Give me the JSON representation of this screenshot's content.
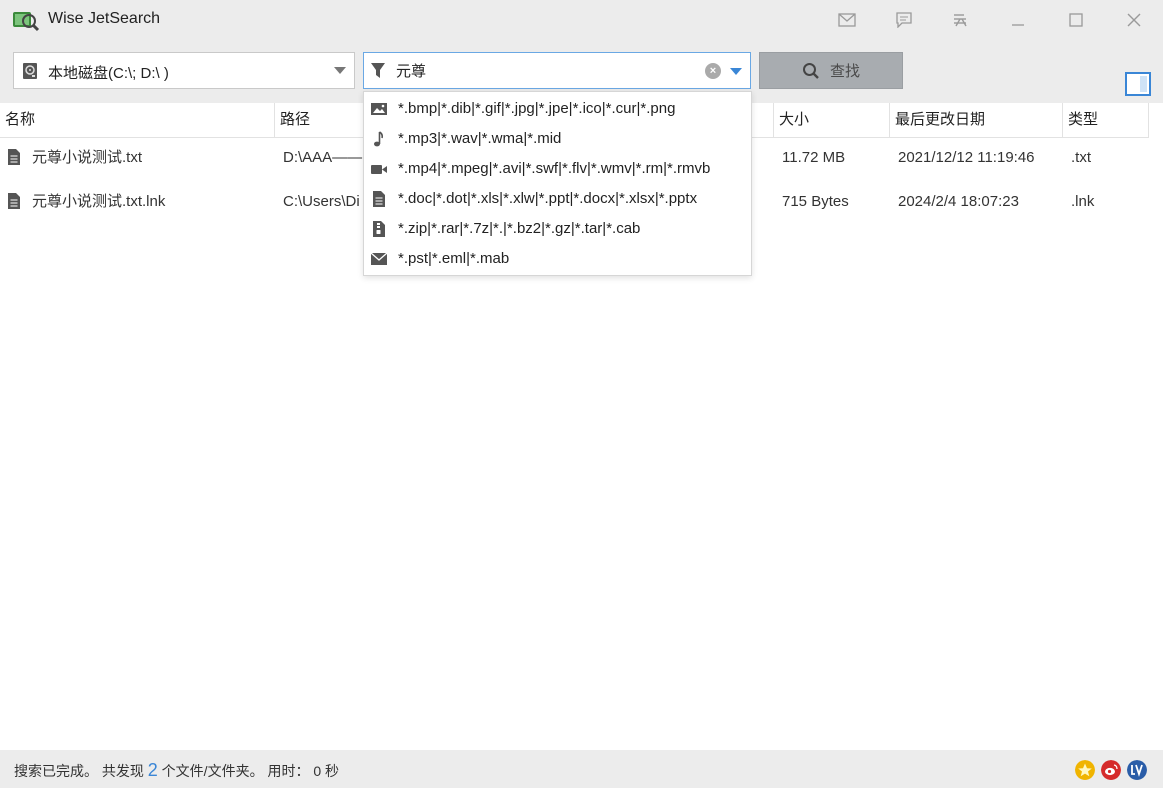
{
  "app": {
    "title": "Wise JetSearch"
  },
  "titlebar_icons": [
    "mail-icon",
    "feedback-icon",
    "menu-icon",
    "minimize-icon",
    "maximize-icon",
    "close-icon"
  ],
  "toolbar": {
    "drive_label": "本地磁盘(C:\\; D:\\ )",
    "search_value": "元尊",
    "find_label": "查找"
  },
  "table": {
    "columns": [
      "名称",
      "路径",
      "大小",
      "最后更改日期",
      "类型"
    ],
    "rows": [
      {
        "name": "元尊小说测试.txt",
        "path": "D:\\AAA——",
        "size": "11.72 MB",
        "date": "2021/12/12 11:19:46",
        "type": ".txt"
      },
      {
        "name": "元尊小说测试.txt.lnk",
        "path": "C:\\Users\\Di",
        "size": "715 Bytes",
        "date": "2024/2/4 18:07:23",
        "type": ".lnk"
      }
    ]
  },
  "filter_dropdown": {
    "items": [
      {
        "icon": "image-icon",
        "label": "*.bmp|*.dib|*.gif|*.jpg|*.jpe|*.ico|*.cur|*.png"
      },
      {
        "icon": "music-icon",
        "label": "*.mp3|*.wav|*.wma|*.mid"
      },
      {
        "icon": "video-icon",
        "label": "*.mp4|*.mpeg|*.avi|*.swf|*.flv|*.wmv|*.rm|*.rmvb"
      },
      {
        "icon": "document-icon",
        "label": "*.doc|*.dot|*.xls|*.xlw|*.ppt|*.docx|*.xlsx|*.pptx"
      },
      {
        "icon": "archive-icon",
        "label": "*.zip|*.rar|*.7z|*.|*.bz2|*.gz|*.tar|*.cab"
      },
      {
        "icon": "mail-icon",
        "label": "*.pst|*.eml|*.mab"
      }
    ]
  },
  "status": {
    "prefix": "搜索已完成。 共发现 ",
    "count": "2",
    "suffix": " 个文件/文件夹。 用时： 0 秒"
  },
  "colors": {
    "accent": "#3a86d6",
    "button": "#a8acb0",
    "background": "#ececec"
  }
}
